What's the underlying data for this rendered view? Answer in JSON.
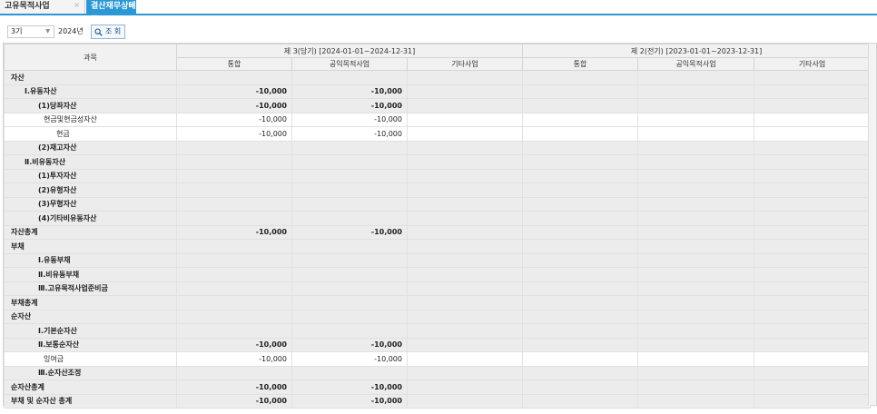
{
  "tabs": [
    {
      "label": "고유목적사업",
      "close": "×"
    },
    {
      "label": "결산재무상태표",
      "close": "×"
    }
  ],
  "toolbar": {
    "period": "3기",
    "year": "2024년",
    "search_label": "조 회"
  },
  "table": {
    "account_header": "과목",
    "current_period": "제 3(당기) [2024-01-01~2024-12-31]",
    "previous_period": "제 2(전기) [2023-01-01~2023-12-31]",
    "sub_headers": [
      "통합",
      "공익목적사업",
      "기타사업",
      "통합",
      "공익목적사업",
      "기타사업"
    ],
    "rows": [
      {
        "label": "자산",
        "level": "lv0",
        "bold": true,
        "shaded": true,
        "values": [
          "",
          "",
          "",
          "",
          "",
          ""
        ]
      },
      {
        "label": "Ⅰ.유동자산",
        "level": "lv1",
        "bold": true,
        "shaded": true,
        "values": [
          "-10,000",
          "-10,000",
          "",
          "",
          "",
          ""
        ]
      },
      {
        "label": "(1)당좌자산",
        "level": "lv2",
        "bold": true,
        "shaded": true,
        "values": [
          "-10,000",
          "-10,000",
          "",
          "",
          "",
          ""
        ]
      },
      {
        "label": "현금및현금성자산",
        "level": "lv3",
        "bold": false,
        "shaded": false,
        "values": [
          "-10,000",
          "-10,000",
          "",
          "",
          "",
          ""
        ]
      },
      {
        "label": "현금",
        "level": "lv3b",
        "bold": false,
        "shaded": false,
        "values": [
          "-10,000",
          "-10,000",
          "",
          "",
          "",
          ""
        ]
      },
      {
        "label": "(2)재고자산",
        "level": "lv2",
        "bold": true,
        "shaded": true,
        "values": [
          "",
          "",
          "",
          "",
          "",
          ""
        ]
      },
      {
        "label": "Ⅱ.비유동자산",
        "level": "lv1",
        "bold": true,
        "shaded": true,
        "values": [
          "",
          "",
          "",
          "",
          "",
          ""
        ]
      },
      {
        "label": "(1)투자자산",
        "level": "lv2",
        "bold": true,
        "shaded": true,
        "values": [
          "",
          "",
          "",
          "",
          "",
          ""
        ]
      },
      {
        "label": "(2)유형자산",
        "level": "lv2",
        "bold": true,
        "shaded": true,
        "values": [
          "",
          "",
          "",
          "",
          "",
          ""
        ]
      },
      {
        "label": "(3)무형자산",
        "level": "lv2",
        "bold": true,
        "shaded": true,
        "values": [
          "",
          "",
          "",
          "",
          "",
          ""
        ]
      },
      {
        "label": "(4)기타비유동자산",
        "level": "lv2",
        "bold": true,
        "shaded": true,
        "values": [
          "",
          "",
          "",
          "",
          "",
          ""
        ]
      },
      {
        "label": "자산총계",
        "level": "lv0",
        "bold": true,
        "shaded": true,
        "values": [
          "-10,000",
          "-10,000",
          "",
          "",
          "",
          ""
        ]
      },
      {
        "label": "부채",
        "level": "lv0",
        "bold": true,
        "shaded": true,
        "values": [
          "",
          "",
          "",
          "",
          "",
          ""
        ]
      },
      {
        "label": "Ⅰ.유동부채",
        "level": "lv2",
        "bold": true,
        "shaded": true,
        "values": [
          "",
          "",
          "",
          "",
          "",
          ""
        ]
      },
      {
        "label": "Ⅱ.비유동부채",
        "level": "lv2",
        "bold": true,
        "shaded": true,
        "values": [
          "",
          "",
          "",
          "",
          "",
          ""
        ]
      },
      {
        "label": "Ⅲ.고유목적사업준비금",
        "level": "lv2",
        "bold": true,
        "shaded": true,
        "values": [
          "",
          "",
          "",
          "",
          "",
          ""
        ]
      },
      {
        "label": "부채총계",
        "level": "lv0",
        "bold": true,
        "shaded": true,
        "values": [
          "",
          "",
          "",
          "",
          "",
          ""
        ]
      },
      {
        "label": "순자산",
        "level": "lv0",
        "bold": true,
        "shaded": true,
        "values": [
          "",
          "",
          "",
          "",
          "",
          ""
        ]
      },
      {
        "label": "Ⅰ.기본순자산",
        "level": "lv2",
        "bold": true,
        "shaded": true,
        "values": [
          "",
          "",
          "",
          "",
          "",
          ""
        ]
      },
      {
        "label": "Ⅱ.보통순자산",
        "level": "lv2",
        "bold": true,
        "shaded": true,
        "values": [
          "-10,000",
          "-10,000",
          "",
          "",
          "",
          ""
        ]
      },
      {
        "label": "잉여금",
        "level": "lv3",
        "bold": false,
        "shaded": false,
        "values": [
          "-10,000",
          "-10,000",
          "",
          "",
          "",
          ""
        ]
      },
      {
        "label": "Ⅲ.순자산조정",
        "level": "lv2",
        "bold": true,
        "shaded": true,
        "values": [
          "",
          "",
          "",
          "",
          "",
          ""
        ]
      },
      {
        "label": "순자산총계",
        "level": "lv0",
        "bold": true,
        "shaded": true,
        "values": [
          "-10,000",
          "-10,000",
          "",
          "",
          "",
          ""
        ]
      },
      {
        "label": "부채 및 순자산 총계",
        "level": "lv0",
        "bold": true,
        "shaded": true,
        "values": [
          "-10,000",
          "-10,000",
          "",
          "",
          "",
          ""
        ]
      }
    ]
  }
}
